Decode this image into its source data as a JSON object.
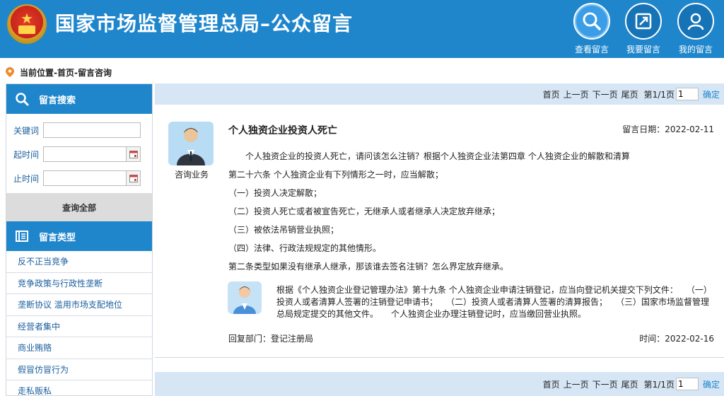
{
  "header": {
    "title": "国家市场监督管理总局–公众留言",
    "nav": [
      {
        "label": "查看留言",
        "icon": "search-icon",
        "active": true
      },
      {
        "label": "我要留言",
        "icon": "edit-icon",
        "active": false
      },
      {
        "label": "我的留言",
        "icon": "user-icon",
        "active": false
      }
    ]
  },
  "breadcrumb": "当前位置-首页-留言咨询",
  "sidebar": {
    "search_title": "留言搜索",
    "keyword_label": "关键词",
    "start_label": "起时间",
    "end_label": "止时间",
    "query_all": "查询全部",
    "category_title": "留言类型",
    "categories": [
      "反不正当竞争",
      "竞争政策与行政性垄断",
      "垄断协议 滥用市场支配地位",
      "经营者集中",
      "商业贿赂",
      "假冒仿冒行为",
      "走私贩私"
    ]
  },
  "pager": {
    "first": "首页",
    "prev": "上一页",
    "next": "下一页",
    "last": "尾页",
    "info": "第1/1页",
    "page_value": "1",
    "confirm": "确定"
  },
  "message": {
    "category": "咨询业务",
    "title": "个人独资企业投资人死亡",
    "date": "留言日期：2022-02-11",
    "lines": [
      "个人独资企业的投资人死亡，请问该怎么注销？根据个人独资企业法第四章 个人独资企业的解散和清算",
      "第二十六条 个人独资企业有下列情形之一时，应当解散；",
      "（一）投资人决定解散；",
      "（二）投资人死亡或者被宣告死亡，无继承人或者继承人决定放弃继承；",
      "（三）被依法吊销营业执照；",
      "（四）法律、行政法规规定的其他情形。",
      "第二条类型如果没有继承人继承，那该谁去签名注销？怎么界定放弃继承。"
    ]
  },
  "reply": {
    "text": "根据《个人独资企业登记管理办法》第十九条 个人独资企业申请注销登记，应当向登记机关提交下列文件：　　（一）投资人或者清算人签署的注销登记申请书；　　（二）投资人或者清算人签署的清算报告；　　（三）国家市场监督管理总局规定提交的其他文件。　　个人独资企业办理注销登记时，应当缴回营业执照。",
    "dept": "回复部门：登记注册局",
    "time": "时间：2022-02-16"
  },
  "colors": {
    "header_blue": "#1f86cc",
    "pager_bg": "#d6e6f5",
    "link_blue": "#1a5f9e"
  }
}
